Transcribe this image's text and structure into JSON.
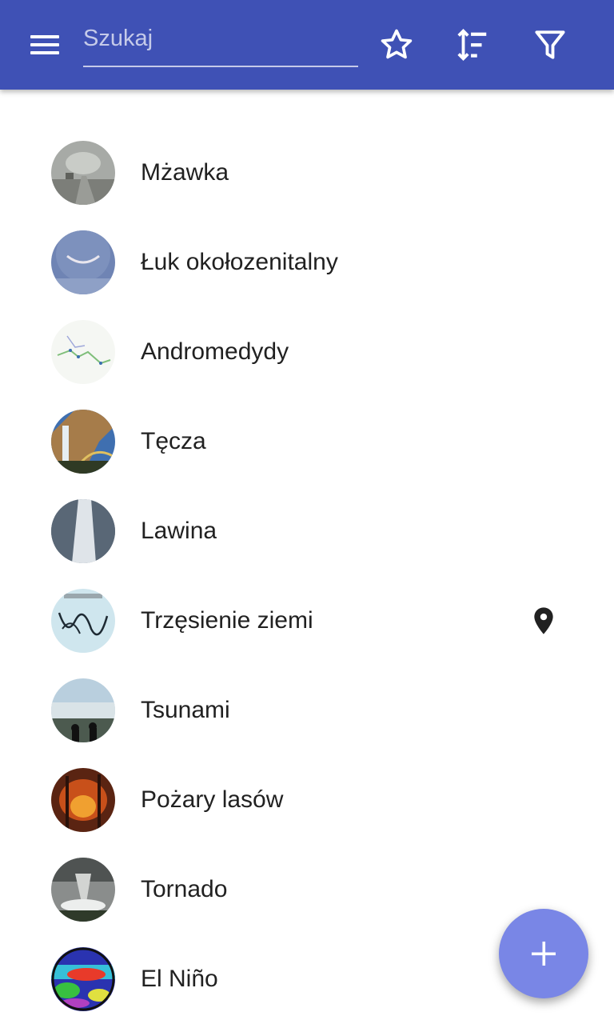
{
  "search": {
    "placeholder": "Szukaj"
  },
  "colors": {
    "appbar": "#3f51b5",
    "fab": "#7986e6",
    "text": "#212121"
  },
  "items": [
    {
      "label": "Mżawka"
    },
    {
      "label": "Łuk okołozenitalny"
    },
    {
      "label": "Andromedydy"
    },
    {
      "label": "Tęcza"
    },
    {
      "label": "Lawina"
    },
    {
      "label": "Trzęsienie ziemi",
      "icon": "location-pin-icon"
    },
    {
      "label": "Tsunami"
    },
    {
      "label": "Pożary lasów"
    },
    {
      "label": "Tornado"
    },
    {
      "label": "El Niño"
    }
  ],
  "icons": [
    "menu-icon",
    "star-icon",
    "sort-icon",
    "filter-icon",
    "location-pin-icon",
    "plus-icon"
  ]
}
